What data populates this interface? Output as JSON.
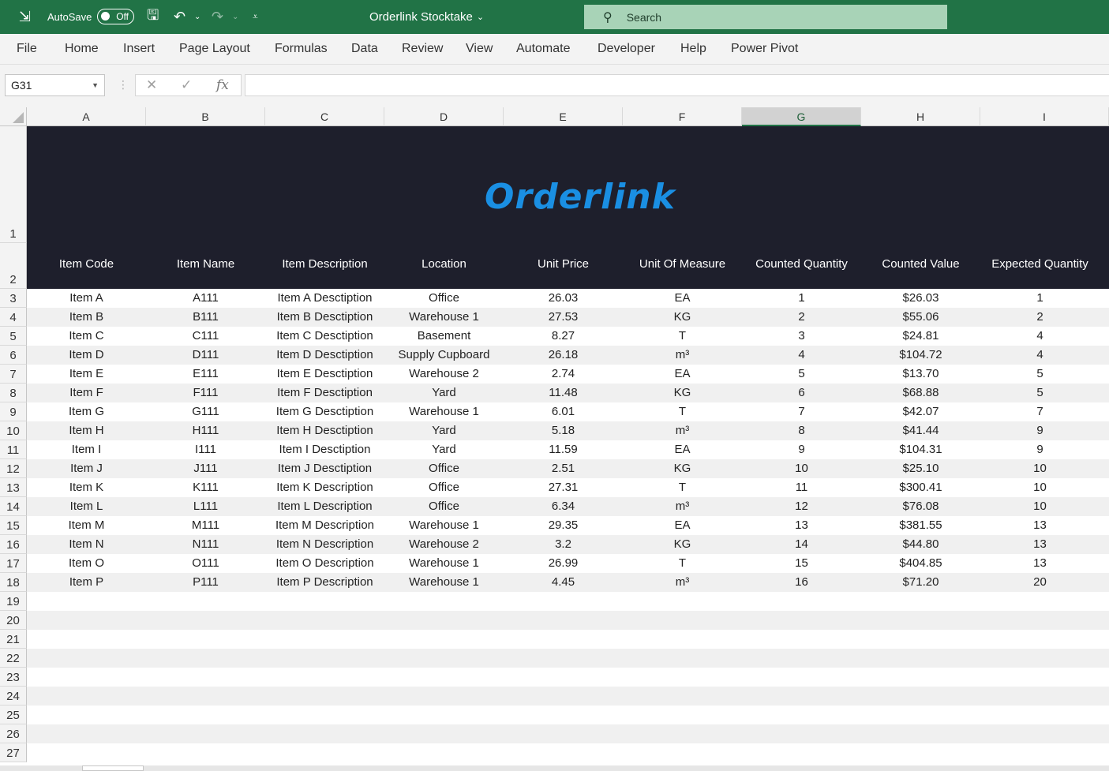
{
  "titlebar": {
    "autosave_label": "AutoSave",
    "autosave_state": "Off",
    "doc_title": "Orderlink Stocktake",
    "search_placeholder": "Search"
  },
  "menu": [
    "File",
    "Home",
    "Insert",
    "Page Layout",
    "Formulas",
    "Data",
    "Review",
    "View",
    "Automate",
    "Developer",
    "Help",
    "Power Pivot"
  ],
  "formula_bar": {
    "name_box": "G31",
    "formula": ""
  },
  "columns": [
    "A",
    "B",
    "C",
    "D",
    "E",
    "F",
    "G",
    "H",
    "I"
  ],
  "selected_column": "G",
  "logo_text": "Orderlink",
  "table": {
    "headers": [
      "Item Code",
      "Item Name",
      "Item Description",
      "Location",
      "Unit Price",
      "Unit Of Measure",
      "Counted Quantity",
      "Counted Value",
      "Expected Quantity"
    ],
    "rows": [
      [
        "Item A",
        "A111",
        "Item A Desctiption",
        "Office",
        "26.03",
        "EA",
        "1",
        "$26.03",
        "1"
      ],
      [
        "Item B",
        "B111",
        "Item B Desctiption",
        "Warehouse 1",
        "27.53",
        "KG",
        "2",
        "$55.06",
        "2"
      ],
      [
        "Item C",
        "C111",
        "Item C Desctiption",
        "Basement",
        "8.27",
        "T",
        "3",
        "$24.81",
        "4"
      ],
      [
        "Item D",
        "D111",
        "Item D Desctiption",
        "Supply Cupboard",
        "26.18",
        "m³",
        "4",
        "$104.72",
        "4"
      ],
      [
        "Item E",
        "E111",
        "Item E Desctiption",
        "Warehouse 2",
        "2.74",
        "EA",
        "5",
        "$13.70",
        "5"
      ],
      [
        "Item F",
        "F111",
        "Item F Desctiption",
        "Yard",
        "11.48",
        "KG",
        "6",
        "$68.88",
        "5"
      ],
      [
        "Item G",
        "G111",
        "Item G Desctiption",
        "Warehouse 1",
        "6.01",
        "T",
        "7",
        "$42.07",
        "7"
      ],
      [
        "Item H",
        "H111",
        "Item H Desctiption",
        "Yard",
        "5.18",
        "m³",
        "8",
        "$41.44",
        "9"
      ],
      [
        "Item I",
        "I111",
        "Item I Desctiption",
        "Yard",
        "11.59",
        "EA",
        "9",
        "$104.31",
        "9"
      ],
      [
        "Item J",
        "J111",
        "Item J Desctiption",
        "Office",
        "2.51",
        "KG",
        "10",
        "$25.10",
        "10"
      ],
      [
        "Item K",
        "K111",
        "Item K Description",
        "Office",
        "27.31",
        "T",
        "11",
        "$300.41",
        "10"
      ],
      [
        "Item L",
        "L111",
        "Item L Description",
        "Office",
        "6.34",
        "m³",
        "12",
        "$76.08",
        "10"
      ],
      [
        "Item M",
        "M111",
        "Item M Description",
        "Warehouse 1",
        "29.35",
        "EA",
        "13",
        "$381.55",
        "13"
      ],
      [
        "Item N",
        "N111",
        "Item N Description",
        "Warehouse 2",
        "3.2",
        "KG",
        "14",
        "$44.80",
        "13"
      ],
      [
        "Item O",
        "O111",
        "Item O Description",
        "Warehouse 1",
        "26.99",
        "T",
        "15",
        "$404.85",
        "13"
      ],
      [
        "Item P",
        "P111",
        "Item P Description",
        "Warehouse 1",
        "4.45",
        "m³",
        "16",
        "$71.20",
        "20"
      ]
    ]
  },
  "row_numbers": [
    "1",
    "2",
    "3",
    "4",
    "5",
    "6",
    "7",
    "8",
    "9",
    "10",
    "11",
    "12",
    "13",
    "14",
    "15",
    "16",
    "17",
    "18",
    "19",
    "20",
    "21",
    "22",
    "23",
    "24",
    "25",
    "26",
    "27"
  ],
  "colors": {
    "excel_green": "#217346",
    "banner": "#1e1f2c",
    "logo": "#1a8fe3"
  }
}
